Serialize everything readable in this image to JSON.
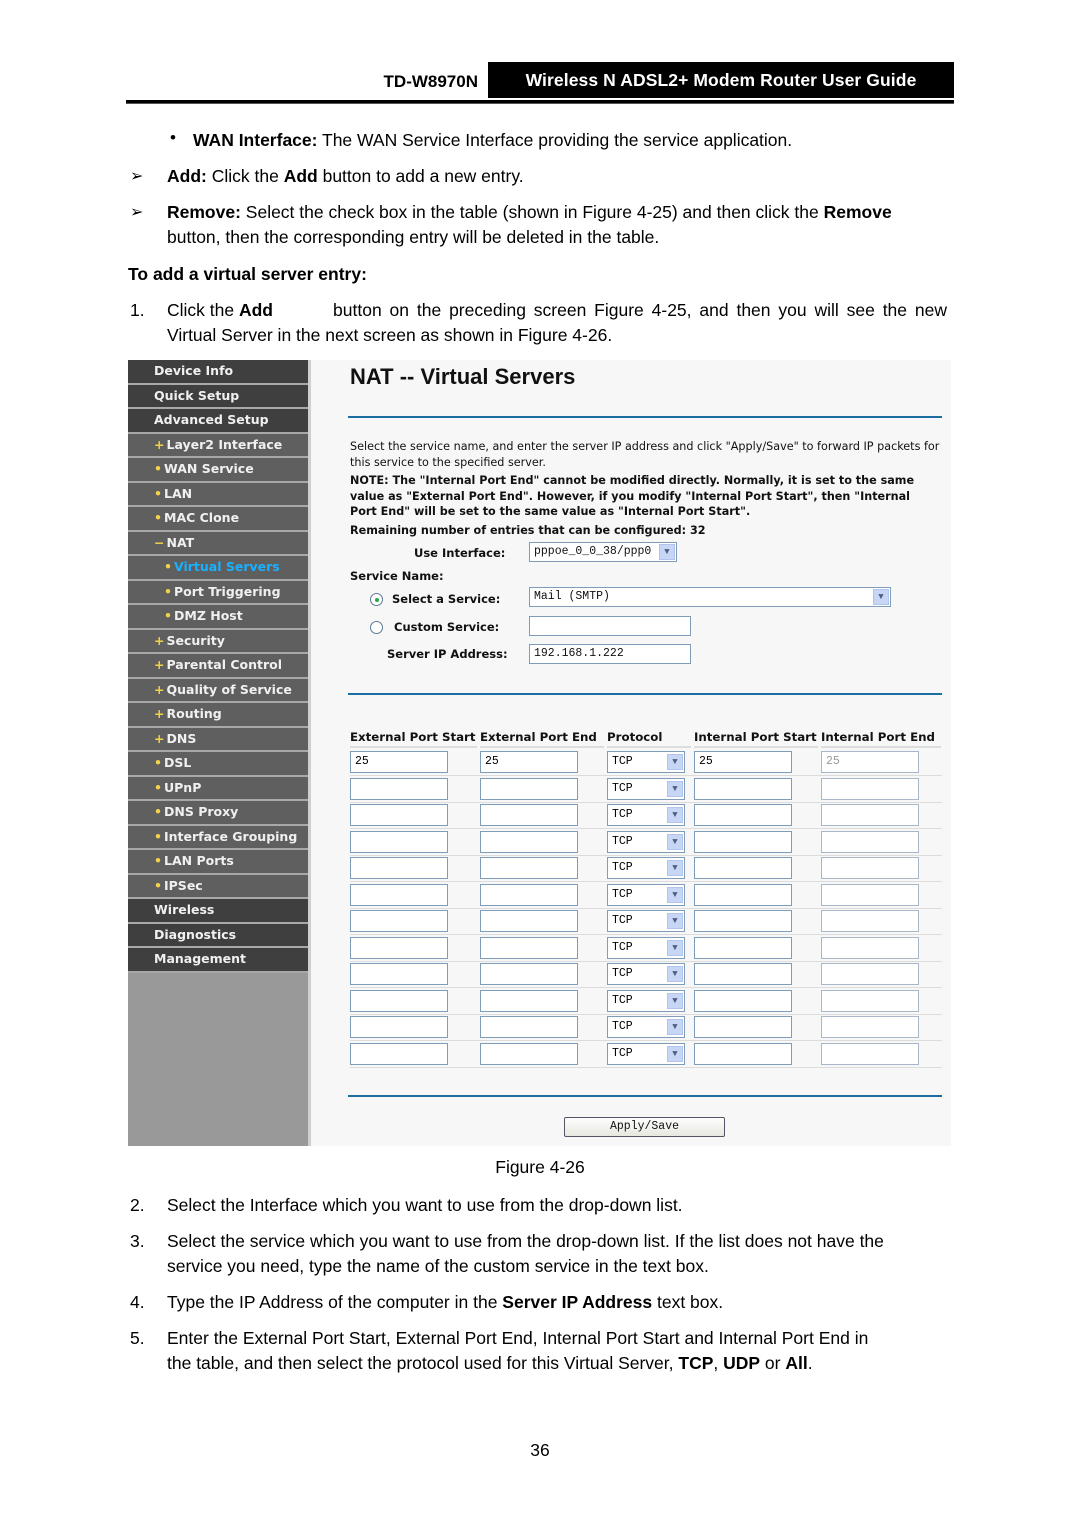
{
  "header": {
    "model": "TD-W8970N",
    "guide_title": "Wireless N ADSL2+ Modem Router User Guide"
  },
  "intro": {
    "wan_interface_label": "WAN Interface:",
    "wan_interface_text": " The WAN Service Interface providing the service application.",
    "add_label": "Add:",
    "add_text_1": " Click the ",
    "add_bold": "Add",
    "add_text_2": " button to add a new entry.",
    "remove_label": "Remove:",
    "remove_text_1": " Select the check box in the table (shown in Figure 4-25) and then click the ",
    "remove_bold": "Remove",
    "remove_text_2": "button, then the corresponding entry will be deleted in the table.",
    "section_heading": "To add a virtual server entry:",
    "step1_num": "1.",
    "step1_text_1": "Click the ",
    "step1_bold": "Add",
    "step1_text_2": " button on the preceding screen Figure 4-25, and then you will see the new",
    "step1_text_3": "Virtual Server in the next screen as shown in Figure 4-26."
  },
  "figure": {
    "sidebar": [
      {
        "label": "Device Info",
        "level": "top",
        "mark": ""
      },
      {
        "label": "Quick Setup",
        "level": "top",
        "mark": ""
      },
      {
        "label": "Advanced Setup",
        "level": "top",
        "mark": ""
      },
      {
        "label": "Layer2 Interface",
        "level": "sub",
        "mark": "+"
      },
      {
        "label": "WAN Service",
        "level": "sub",
        "mark": "•"
      },
      {
        "label": "LAN",
        "level": "sub",
        "mark": "•"
      },
      {
        "label": "MAC Clone",
        "level": "sub",
        "mark": "•"
      },
      {
        "label": "NAT",
        "level": "sub",
        "mark": "−"
      },
      {
        "label": "Virtual Servers",
        "level": "sub2",
        "mark": "•",
        "active": true
      },
      {
        "label": "Port Triggering",
        "level": "sub2",
        "mark": "•"
      },
      {
        "label": "DMZ Host",
        "level": "sub2",
        "mark": "•"
      },
      {
        "label": "Security",
        "level": "sub",
        "mark": "+"
      },
      {
        "label": "Parental Control",
        "level": "sub",
        "mark": "+"
      },
      {
        "label": "Quality of Service",
        "level": "sub",
        "mark": "+"
      },
      {
        "label": "Routing",
        "level": "sub",
        "mark": "+"
      },
      {
        "label": "DNS",
        "level": "sub",
        "mark": "+"
      },
      {
        "label": "DSL",
        "level": "sub",
        "mark": "•"
      },
      {
        "label": "UPnP",
        "level": "sub",
        "mark": "•"
      },
      {
        "label": "DNS Proxy",
        "level": "sub",
        "mark": "•"
      },
      {
        "label": "Interface Grouping",
        "level": "sub",
        "mark": "•"
      },
      {
        "label": "LAN Ports",
        "level": "sub",
        "mark": "•"
      },
      {
        "label": "IPSec",
        "level": "sub",
        "mark": "•"
      },
      {
        "label": "Wireless",
        "level": "top",
        "mark": ""
      },
      {
        "label": "Diagnostics",
        "level": "top",
        "mark": ""
      },
      {
        "label": "Management",
        "level": "top",
        "mark": ""
      }
    ],
    "title": "NAT -- Virtual Servers",
    "description": "Select the service name, and enter the server IP address and click \"Apply/Save\" to forward IP packets for this service to the specified server.",
    "note": "NOTE: The \"Internal Port End\" cannot be modified directly. Normally, it is set to the same value as \"External Port End\". However, if you modify \"Internal Port Start\", then \"Internal Port End\" will be set to the same value as \"Internal Port Start\".",
    "remaining": "Remaining number of entries that can be configured: 32",
    "use_interface_label": "Use Interface:",
    "use_interface_value": "pppoe_0_0_38/ppp0",
    "service_name_label": "Service Name:",
    "select_service_label": "Select a Service:",
    "select_service_value": "Mail (SMTP)",
    "select_service_checked": true,
    "custom_service_label": "Custom Service:",
    "custom_service_value": "",
    "custom_service_checked": false,
    "server_ip_label": "Server IP Address:",
    "server_ip_value": "192.168.1.222",
    "table": {
      "headers": [
        "External Port Start",
        "External Port End",
        "Protocol",
        "Internal Port Start",
        "Internal Port End"
      ],
      "rows": [
        [
          "25",
          "25",
          "TCP",
          "25",
          "25"
        ],
        [
          "",
          "",
          "TCP",
          "",
          ""
        ],
        [
          "",
          "",
          "TCP",
          "",
          ""
        ],
        [
          "",
          "",
          "TCP",
          "",
          ""
        ],
        [
          "",
          "",
          "TCP",
          "",
          ""
        ],
        [
          "",
          "",
          "TCP",
          "",
          ""
        ],
        [
          "",
          "",
          "TCP",
          "",
          ""
        ],
        [
          "",
          "",
          "TCP",
          "",
          ""
        ],
        [
          "",
          "",
          "TCP",
          "",
          ""
        ],
        [
          "",
          "",
          "TCP",
          "",
          ""
        ],
        [
          "",
          "",
          "TCP",
          "",
          ""
        ],
        [
          "",
          "",
          "TCP",
          "",
          ""
        ]
      ]
    },
    "apply_label": "Apply/Save",
    "caption": "Figure 4-26"
  },
  "steps": {
    "s2_num": "2.",
    "s2": "Select the Interface which you want to use from the drop-down list.",
    "s3_num": "3.",
    "s3a": "Select the service which you want to use from the drop-down list. If the list does not have the",
    "s3b": "service you need, type the name of the custom service in the text box.",
    "s4_num": "4.",
    "s4_1": "Type the IP Address of the computer in the ",
    "s4_bold": "Server IP Address",
    "s4_2": " text box.",
    "s5_num": "5.",
    "s5a": "Enter the External Port Start, External Port End, Internal Port Start and Internal Port End in",
    "s5b_1": "the table, and then select the protocol used for this Virtual Server, ",
    "s5b_tcp": "TCP",
    "s5b_comma": ", ",
    "s5b_udp": "UDP",
    "s5b_or": " or ",
    "s5b_all": "All",
    "s5b_end": "."
  },
  "page_number": "36"
}
